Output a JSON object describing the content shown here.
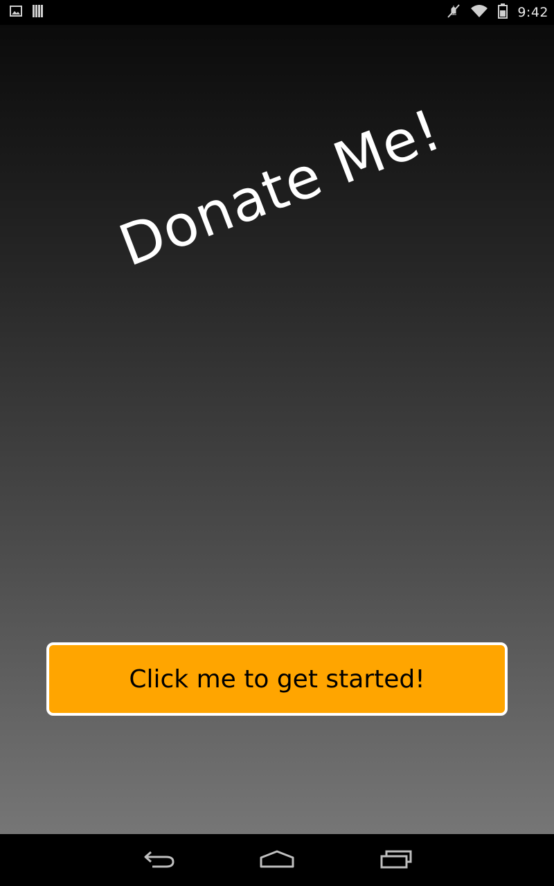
{
  "status_bar": {
    "time": "9:42",
    "left_icons": [
      "gallery-notification-icon",
      "barcode-notification-icon"
    ],
    "right_icons": [
      "mute-icon",
      "wifi-icon",
      "battery-icon"
    ]
  },
  "main": {
    "title": "Donate Me!",
    "start_button_label": "Click me to get started!"
  },
  "nav_bar": {
    "buttons": [
      "back-icon",
      "home-icon",
      "recent-apps-icon"
    ]
  },
  "colors": {
    "button_background": "#ffa500",
    "button_border": "#ffffff",
    "title_text": "#ffffff",
    "gradient_top": "#0b0b0b",
    "gradient_bottom": "#767676"
  }
}
